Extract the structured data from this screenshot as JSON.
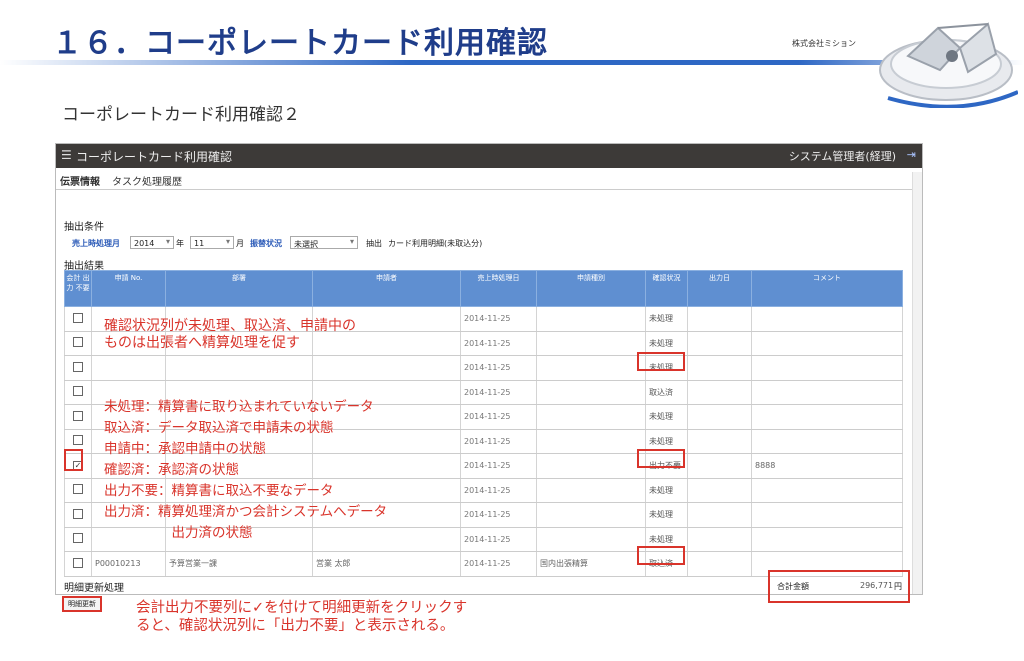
{
  "slide": {
    "title": "１６．コーポレートカード利用確認",
    "company": "株式会社ミション",
    "subtitle": "コーポレートカード利用確認２"
  },
  "app": {
    "title": "コーポレートカード利用確認",
    "user": "システム管理者(経理)",
    "tabs": [
      "伝票情報",
      "タスク処理履歴"
    ]
  },
  "filters": {
    "section_label": "抽出条件",
    "year_month_label": "売上時処理月",
    "year_value": "2014",
    "year_unit": "年",
    "month_value": "11",
    "month_unit": "月",
    "status_label": "振替状況",
    "status_value": "未選択",
    "extract_label": "抽出",
    "extract_value": "カード利用明細(未取込分)"
  },
  "results": {
    "section_label": "抽出結果",
    "columns": [
      "会計 出力 不要",
      "申請 No.",
      "部署",
      "申請者",
      "売上時処理日",
      "申請種別",
      "確認状況",
      "出力日",
      "コメント"
    ],
    "rows": [
      {
        "checked": false,
        "no": "",
        "dept": "",
        "applicant": "",
        "date": "2014-11-25",
        "type": "",
        "status": "未処理",
        "out": "",
        "comment": ""
      },
      {
        "checked": false,
        "no": "",
        "dept": "",
        "applicant": "",
        "date": "2014-11-25",
        "type": "",
        "status": "未処理",
        "out": "",
        "comment": ""
      },
      {
        "checked": false,
        "no": "",
        "dept": "",
        "applicant": "",
        "date": "2014-11-25",
        "type": "",
        "status": "未処理",
        "out": "",
        "comment": ""
      },
      {
        "checked": false,
        "no": "",
        "dept": "",
        "applicant": "",
        "date": "2014-11-25",
        "type": "",
        "status": "取込済",
        "out": "",
        "comment": ""
      },
      {
        "checked": false,
        "no": "",
        "dept": "",
        "applicant": "",
        "date": "2014-11-25",
        "type": "",
        "status": "未処理",
        "out": "",
        "comment": ""
      },
      {
        "checked": false,
        "no": "",
        "dept": "",
        "applicant": "",
        "date": "2014-11-25",
        "type": "",
        "status": "未処理",
        "out": "",
        "comment": ""
      },
      {
        "checked": true,
        "no": "",
        "dept": "",
        "applicant": "",
        "date": "2014-11-25",
        "type": "",
        "status": "出力不要",
        "out": "",
        "comment": "8888"
      },
      {
        "checked": false,
        "no": "",
        "dept": "",
        "applicant": "",
        "date": "2014-11-25",
        "type": "",
        "status": "未処理",
        "out": "",
        "comment": ""
      },
      {
        "checked": false,
        "no": "",
        "dept": "",
        "applicant": "",
        "date": "2014-11-25",
        "type": "",
        "status": "未処理",
        "out": "",
        "comment": ""
      },
      {
        "checked": false,
        "no": "",
        "dept": "",
        "applicant": "",
        "date": "2014-11-25",
        "type": "",
        "status": "未処理",
        "out": "",
        "comment": ""
      },
      {
        "checked": false,
        "no": "P00010213",
        "dept": "予算営業一課",
        "applicant": "営業 太郎",
        "date": "2014-11-25",
        "type": "国内出張精算",
        "status": "取込済",
        "out": "",
        "comment": ""
      }
    ]
  },
  "footer": {
    "update_label": "明細更新処理",
    "update_button": "明細更新",
    "total_label": "合計金額",
    "total_value": "296,771",
    "total_unit": "円"
  },
  "annotations": {
    "note1": [
      "確認状況列が未処理、取込済、申請中の",
      "ものは出張者へ精算処理を促す"
    ],
    "note2": [
      "未処理：精算書に取り込まれていないデータ",
      "取込済：データ取込済で申請未の状態",
      "申請中：承認申請中の状態",
      "確認済：承認済の状態",
      "出力不要：精算書に取込不要なデータ",
      "出力済：精算処理済かつ会計システムへデータ",
      "　　　　　出力済の状態"
    ],
    "note3": [
      "会計出力不要列に✓を付けて明細更新をクリックす",
      "ると、確認状況列に「出力不要」と表示される。"
    ]
  },
  "colors": {
    "accent_red": "#d9342b",
    "title_blue": "#1f3d8a",
    "grid_header": "#5f8fd1"
  }
}
